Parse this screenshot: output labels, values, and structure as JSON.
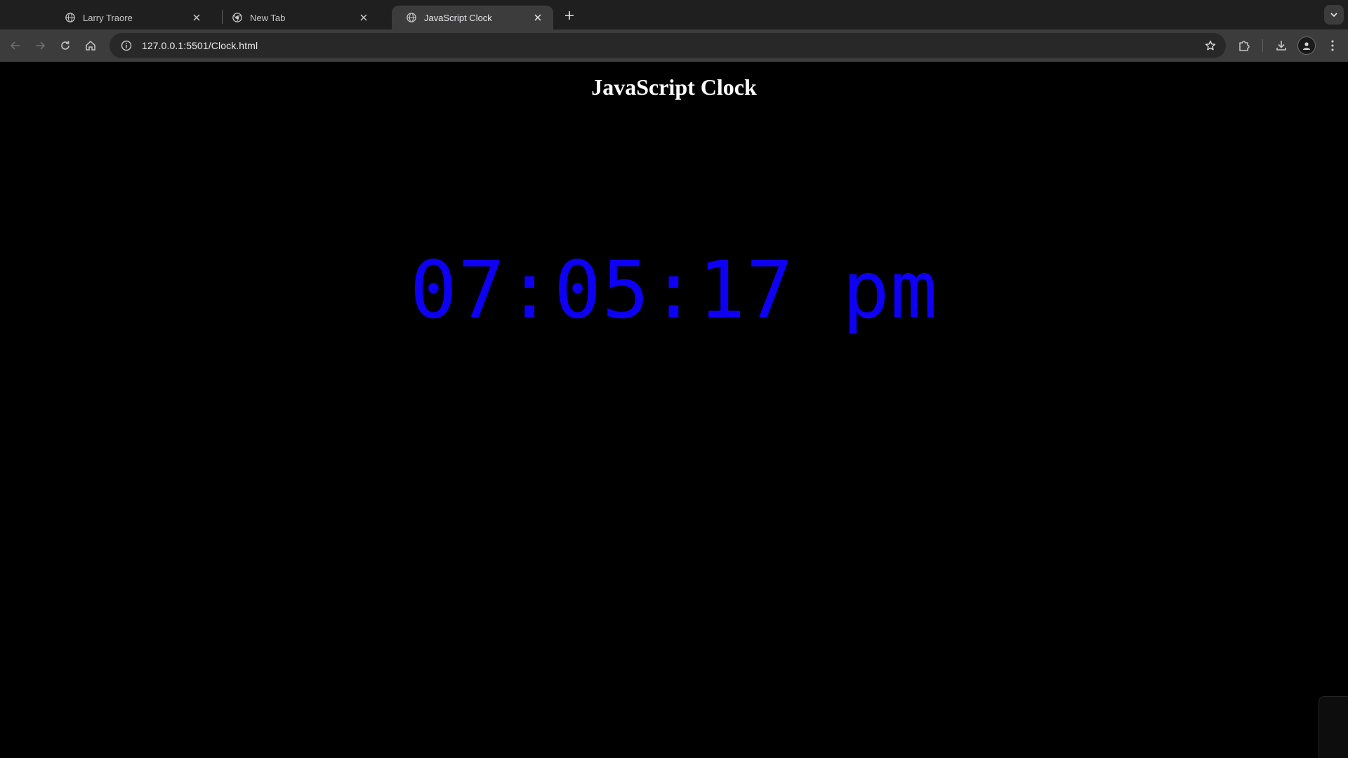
{
  "browser": {
    "tabs": [
      {
        "title": "Larry Traore",
        "icon": "globe-icon",
        "active": false
      },
      {
        "title": "New Tab",
        "icon": "chrome-icon",
        "active": false
      },
      {
        "title": "JavaScript Clock",
        "icon": "globe-icon",
        "active": true
      }
    ],
    "address_bar": {
      "url": "127.0.0.1:5501/Clock.html"
    }
  },
  "page": {
    "heading": "JavaScript Clock",
    "clock_text": "07:05:17 pm",
    "clock_color": "#0d00f5",
    "background": "#000000"
  }
}
